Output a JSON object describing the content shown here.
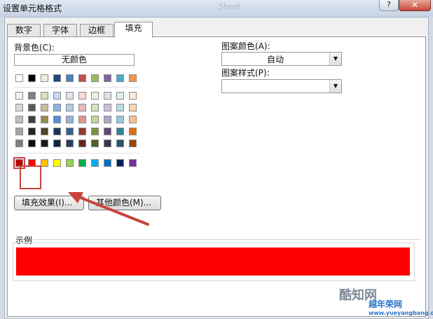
{
  "window": {
    "title": "设置单元格格式",
    "faded_title": "Sheet",
    "help_glyph": "?",
    "close_glyph": "✕"
  },
  "tabs": [
    {
      "label": "数字",
      "active": false
    },
    {
      "label": "字体",
      "active": false
    },
    {
      "label": "边框",
      "active": false
    },
    {
      "label": "填充",
      "active": true
    }
  ],
  "fill": {
    "background_label": "背景色(C):",
    "no_color_label": "无颜色",
    "fill_effects_button": "填充效果(I)...",
    "more_colors_button": "其他颜色(M)...",
    "pattern_color_label": "图案颜色(A):",
    "pattern_color_value": "自动",
    "pattern_style_label": "图案样式(P):",
    "pattern_style_value": "",
    "sample_label": "示例",
    "sample_color": "#ff0000",
    "selected_color": "#c00000"
  },
  "palette": {
    "theme_top": [
      "#ffffff",
      "#000000",
      "#eeece1",
      "#1f497d",
      "#4f81bd",
      "#c0504d",
      "#9bbb59",
      "#8064a2",
      "#4bacc6",
      "#f79646"
    ],
    "theme_shades": [
      [
        "#f2f2f2",
        "#808080",
        "#ddd9c3",
        "#c6d9f0",
        "#dbe5f1",
        "#f2dcdb",
        "#ebf1dd",
        "#e5e0ec",
        "#dbeef3",
        "#fdeada"
      ],
      [
        "#d8d8d8",
        "#595959",
        "#c4bd97",
        "#8db3e2",
        "#b8cce4",
        "#e5b9b7",
        "#d7e3bc",
        "#ccc1d9",
        "#b7dde8",
        "#fbd5b5"
      ],
      [
        "#bfbfbf",
        "#3f3f3f",
        "#938953",
        "#548dd4",
        "#95b3d7",
        "#d99694",
        "#c3d69b",
        "#b2a2c7",
        "#92cddc",
        "#fac08f"
      ],
      [
        "#a5a5a5",
        "#262626",
        "#494429",
        "#17365d",
        "#366092",
        "#953734",
        "#76923c",
        "#5f497a",
        "#31859b",
        "#e36c09"
      ],
      [
        "#7f7f7f",
        "#0c0c0c",
        "#1d1b10",
        "#0f243e",
        "#244061",
        "#632423",
        "#4f6128",
        "#3f3151",
        "#205867",
        "#974806"
      ]
    ],
    "standard": [
      "#c00000",
      "#ff0000",
      "#ffc000",
      "#ffff00",
      "#92d050",
      "#00b050",
      "#00b0f0",
      "#0070c0",
      "#002060",
      "#7030a0"
    ]
  },
  "watermark": {
    "text1": "酷知网",
    "text2": "越年荣网",
    "text3": "www.yueyangbang.com"
  }
}
